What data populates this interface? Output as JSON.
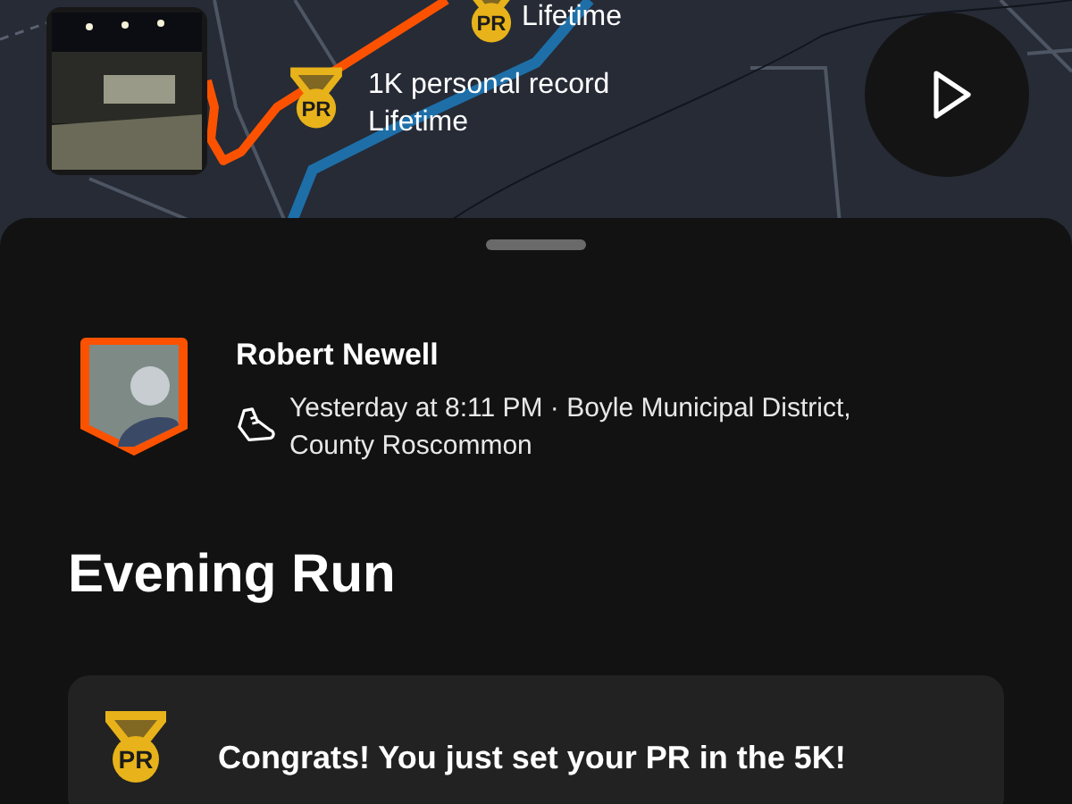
{
  "map": {
    "markers": [
      {
        "badge": "PR",
        "lines": [
          "Lifetime"
        ]
      },
      {
        "badge": "PR",
        "lines": [
          "1K personal record",
          "Lifetime"
        ]
      }
    ]
  },
  "athlete": {
    "name": "Robert Newell",
    "details": "Yesterday at 8:11 PM · Boyle Municipal District, County Roscommon"
  },
  "title": "Evening Run",
  "achievement": {
    "badge": "PR",
    "message": "Congrats! You just set your PR in the 5K!"
  }
}
